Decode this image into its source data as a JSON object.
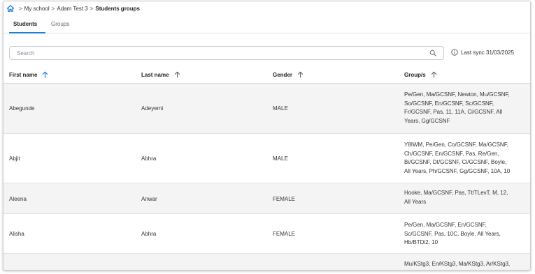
{
  "breadcrumb": {
    "items": [
      "My school",
      "Adam Test 3"
    ],
    "current": "Students groups",
    "separator": ">"
  },
  "tabs": [
    {
      "label": "Students",
      "active": true
    },
    {
      "label": "Groups",
      "active": false
    }
  ],
  "search": {
    "placeholder": "Search",
    "value": ""
  },
  "sync": {
    "text": "Last sync 31/03/2025"
  },
  "table": {
    "headers": [
      "First name",
      "Last name",
      "Gender",
      "Group/s"
    ],
    "rows": [
      {
        "first": "Abegunde",
        "last": "Adeyemi",
        "gender": "MALE",
        "groups": [
          "Pe/Gen, Ma/GCSNF, Newton, Mu/GCSNF,",
          "So/GCSNF, En/GCSNF, Sc/GCSNF,",
          "Fr/GCSNF, Pas, 11, 11A, Ci/GCSNF, All",
          "Years, Gg/GCSNF"
        ]
      },
      {
        "first": "Abjit",
        "last": "Abhra",
        "gender": "MALE",
        "groups": [
          "Y8IWM, Pe/Gen, Co/GCSNF, Ma/GCSNF,",
          "Ch/GCSNF, En/GCSNF, Pas, Re/Gen,",
          "Bi/GCSNF, Dt/GCSNF, Ci/GCSNF, Boyle,",
          "All Years, Ph/GCSNF, Gg/GCSNF, 10A, 10"
        ]
      },
      {
        "first": "Aleena",
        "last": "Anwar",
        "gender": "FEMALE",
        "groups": [
          "Hooke, Ma/GCSNF, Pas, Tt/TLevT, M, 12,",
          "All Years"
        ]
      },
      {
        "first": "Alisha",
        "last": "Abhra",
        "gender": "FEMALE",
        "groups": [
          "Pe/Gen, Ma/GCSNF, En/GCSNF,",
          "Sc/GCSNF, Pas, 10C, Boyle, All Years,",
          "Hb/BTDi2, 10"
        ]
      },
      {
        "first": "",
        "last": "",
        "gender": "",
        "groups": [
          "Mu/KStg3, En/KStg3, Ma/KStg3, Ar/KStg3,"
        ]
      }
    ]
  },
  "colors": {
    "accent": "#1f7fd9",
    "row_alt": "#f4f4f5",
    "border": "#c9ccd2"
  },
  "icons": {
    "home": "home-icon",
    "search": "search-icon",
    "info": "info-icon",
    "sort": "arrow-up-icon"
  }
}
